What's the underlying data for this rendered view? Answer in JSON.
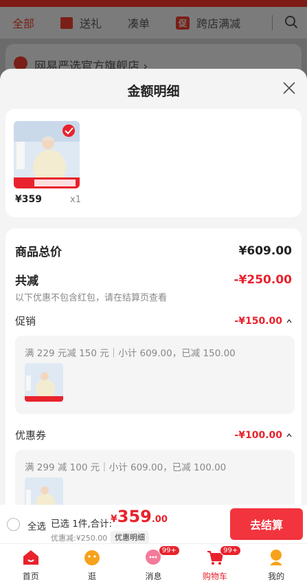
{
  "background": {
    "tabs": [
      "全部",
      "送礼",
      "凑单",
      "跨店满减"
    ],
    "promo_tag": "促",
    "shop_name": "网易严选官方旗舰店 ›"
  },
  "sheet": {
    "title": "金额明细",
    "product": {
      "price": "¥359",
      "qty": "x1"
    },
    "summary": {
      "total_label": "商品总价",
      "total_value": "¥609.00",
      "reduce_label": "共减",
      "reduce_value": "-¥250.00",
      "reduce_note": "以下优惠不包含红包，请在结算页查看"
    },
    "promotion": {
      "label": "促销",
      "value": "-¥150.00",
      "detail": "满 229 元减 150 元｜小计 609.00，已减 150.00"
    },
    "coupon": {
      "label": "优惠券",
      "value": "-¥100.00",
      "detail": "满 299 减 100 元｜小计 609.00，已减 100.00"
    }
  },
  "checkout": {
    "select_all": "全选",
    "selected": "已选 1件,合计:",
    "currency": "¥",
    "total_int": "359",
    "total_dec": ".00",
    "discount": "优惠减:¥250.00",
    "detail_link": "优惠明细",
    "pay_button": "去结算"
  },
  "nav": {
    "items": [
      {
        "label": "首页",
        "icon": "home-icon"
      },
      {
        "label": "逛",
        "icon": "browse-icon"
      },
      {
        "label": "消息",
        "icon": "message-icon",
        "badge": "99+"
      },
      {
        "label": "购物车",
        "icon": "cart-icon",
        "badge": "99+"
      },
      {
        "label": "我的",
        "icon": "profile-icon"
      }
    ]
  },
  "colors": {
    "accent": "#e8232d",
    "button": "#f2343e"
  }
}
